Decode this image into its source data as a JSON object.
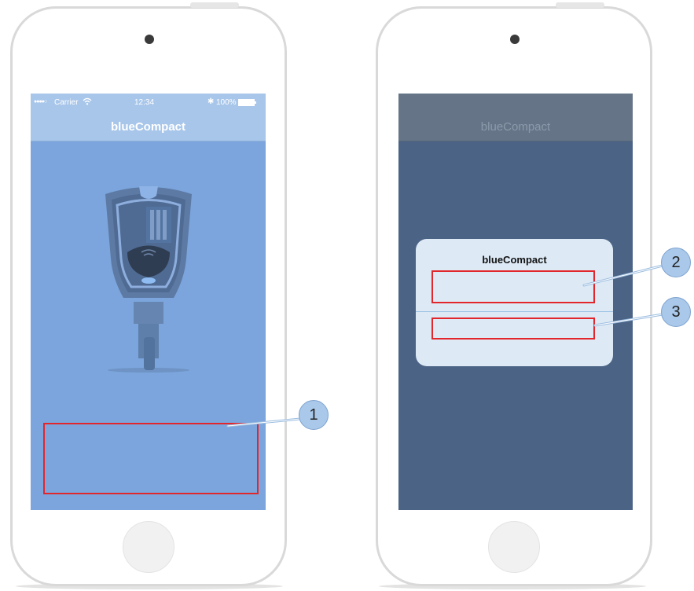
{
  "left_phone": {
    "status_bar": {
      "signal": "●●●●○",
      "carrier": "Carrier",
      "time": "12:34",
      "bluetooth": "✱",
      "battery_text": "100%"
    },
    "nav_title": "blueCompact",
    "callout": "1"
  },
  "right_phone": {
    "nav_title": "blueCompact",
    "dialog_title": "blueCompact",
    "callout_message": "2",
    "callout_button": "3"
  },
  "colors": {
    "left_screen_bg": "#7ba5dc",
    "left_navbar_bg": "#a8c6ea",
    "right_screen_bg": "#4b6385",
    "right_navbar_bg": "#657587",
    "highlight_border": "#e3262b",
    "callout_fill": "#a9c8ea"
  },
  "icons": [
    "key-illustration-icon",
    "wifi-icon",
    "bluetooth-icon",
    "battery-icon"
  ]
}
